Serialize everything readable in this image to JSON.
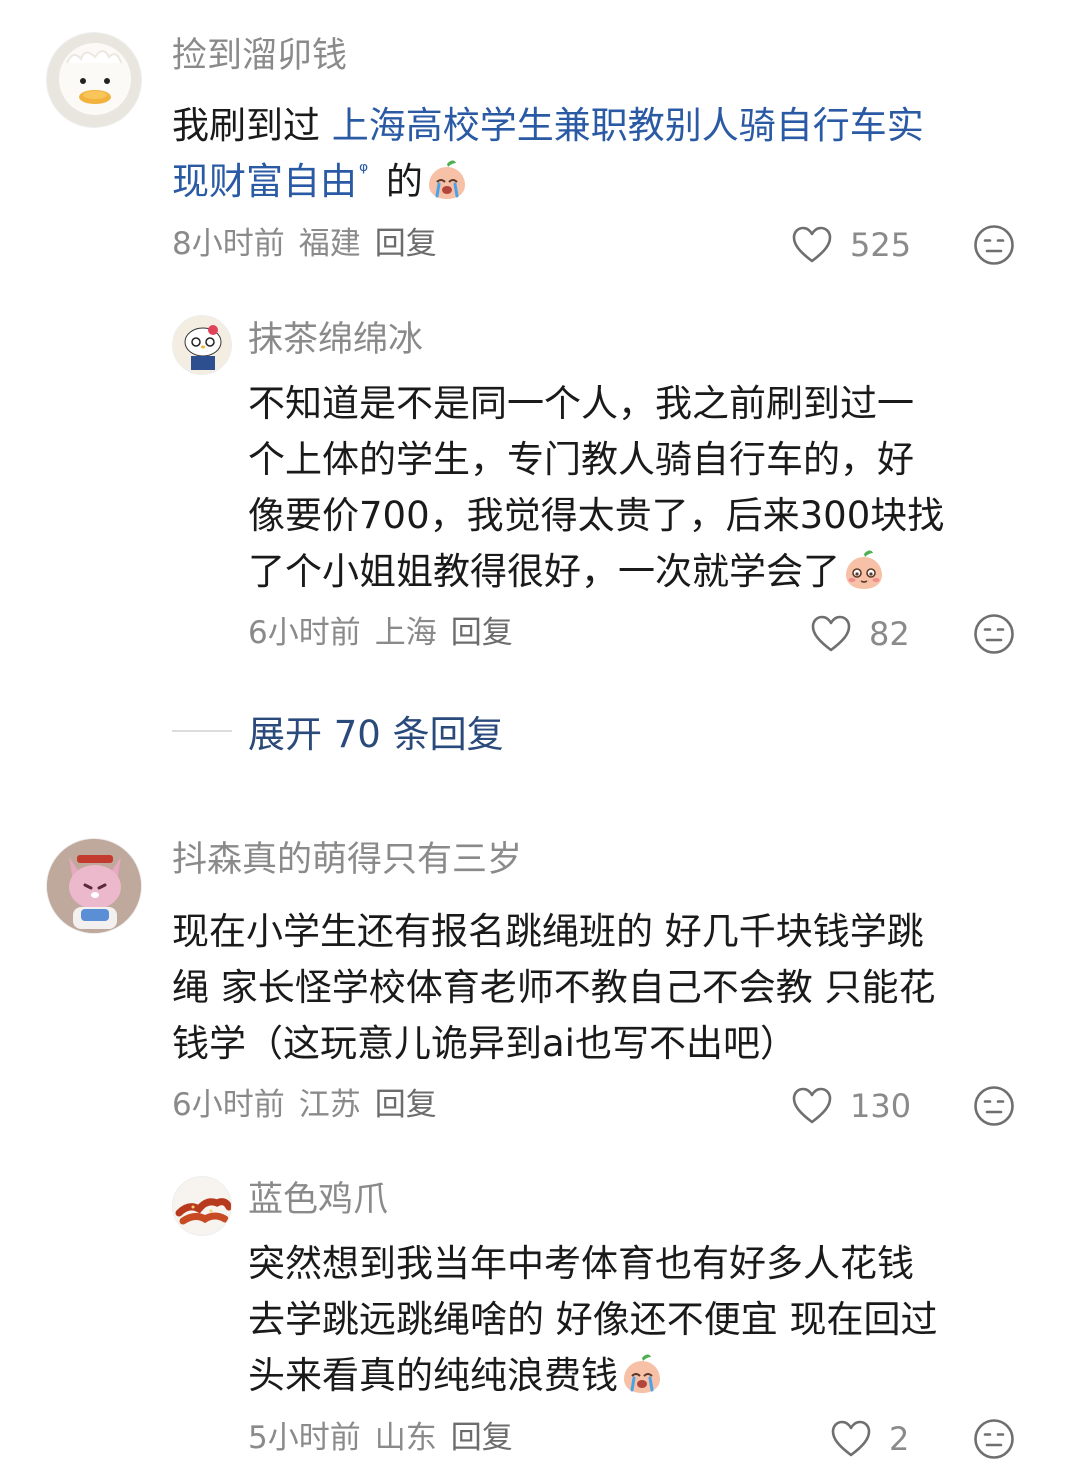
{
  "comments": [
    {
      "username": "捡到溜卯钱",
      "text_before": "我刷到过 ",
      "text_link_line1": "上海高校学生兼职教别人骑自行车实",
      "text_link_line2": "现财富自由",
      "text_after": " 的",
      "time": "8小时前",
      "location": "福建",
      "reply_label": "回复",
      "likes": "525",
      "replies": [
        {
          "username": "抹茶绵绵冰",
          "lines": [
            "不知道是不是同一个人，我之前刷到过一",
            "个上体的学生，专门教人骑自行车的，好",
            "像要价700，我觉得太贵了，后来300块找",
            "了个小姐姐教得很好，一次就学会了"
          ],
          "time": "6小时前",
          "location": "上海",
          "reply_label": "回复",
          "likes": "82"
        }
      ],
      "expand_label": "展开 70 条回复"
    },
    {
      "username": "抖森真的萌得只有三岁",
      "lines": [
        "现在小学生还有报名跳绳班的 好几千块钱学跳",
        "绳 家长怪学校体育老师不教自己不会教 只能花",
        "钱学（这玩意儿诡异到ai也写不出吧）"
      ],
      "time": "6小时前",
      "location": "江苏",
      "reply_label": "回复",
      "likes": "130",
      "replies": [
        {
          "username": "蓝色鸡爪",
          "lines": [
            "突然想到我当年中考体育也有好多人花钱",
            "去学跳远跳绳啥的 好像还不便宜 现在回过",
            "头来看真的纯纯浪费钱"
          ],
          "time": "5小时前",
          "location": "山东",
          "reply_label": "回复",
          "likes": "2"
        }
      ]
    }
  ],
  "icons": {
    "like": "heart-outline-icon",
    "dislike": "meh-face-icon",
    "search_hint": "search-icon",
    "emoji_cry": "crying-peach-emoji",
    "emoji_shy": "shy-peach-emoji"
  }
}
